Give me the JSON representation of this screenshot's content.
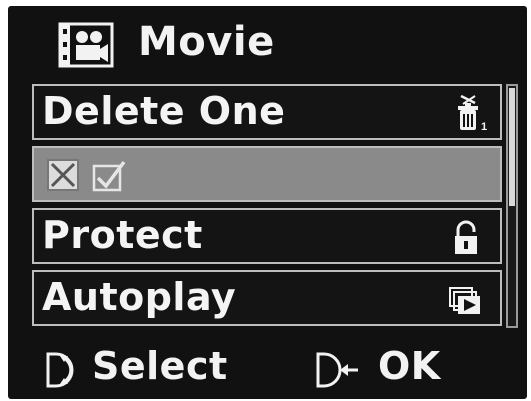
{
  "header": {
    "title": "Movie",
    "icon": "movie-camera-icon"
  },
  "menu": {
    "items": [
      {
        "label": "Delete One",
        "icon": "delete-one-icon",
        "badge": "1",
        "selected": false
      },
      {
        "label": "",
        "icons": [
          "cancel-x-icon",
          "confirm-check-icon"
        ],
        "selected": true
      },
      {
        "label": "Protect",
        "icon": "lock-icon",
        "selected": false
      },
      {
        "label": "Autoplay",
        "icon": "slideshow-icon",
        "selected": false
      }
    ]
  },
  "scroll": {
    "position_fraction": 0.5
  },
  "footer": {
    "select_label": "Select",
    "ok_label": "OK",
    "select_icon": "dial-icon",
    "ok_icon": "ok-arrow-icon"
  },
  "colors": {
    "background": "#111111",
    "selected_row": "#8a8a8a",
    "row_border": "#bdbdbd",
    "text": "#f4f4f4"
  }
}
